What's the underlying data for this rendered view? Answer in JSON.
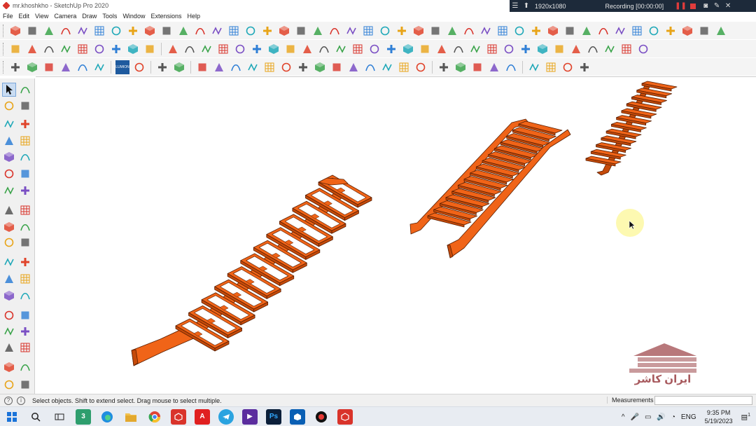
{
  "window": {
    "title": "mr.khoshkho - SketchUp Pro 2020",
    "app_icon": "sketchup-icon"
  },
  "recorder": {
    "resolution": "1920x1080",
    "status": "Recording [00:00:00]"
  },
  "menu": {
    "items": [
      "File",
      "Edit",
      "View",
      "Camera",
      "Draw",
      "Tools",
      "Window",
      "Extensions",
      "Help"
    ]
  },
  "toolbar3": {
    "lumion_label": "LUMION"
  },
  "statusbar": {
    "hint": "Select objects. Shift to extend select. Drag mouse to select multiple.",
    "measurements_label": "Measurements",
    "measurements_value": ""
  },
  "watermark": {
    "text": "ایران کاشر"
  },
  "taskbar": {
    "language": "ENG",
    "time": "9:35 PM",
    "date": "5/19/2023",
    "notification_count": "1",
    "badge_3": "3"
  },
  "colors": {
    "stair_orange": "#f06418",
    "stair_edge": "#5a1e00",
    "accent_red": "#d9342b",
    "recorder_bg": "#1d2a3a"
  }
}
